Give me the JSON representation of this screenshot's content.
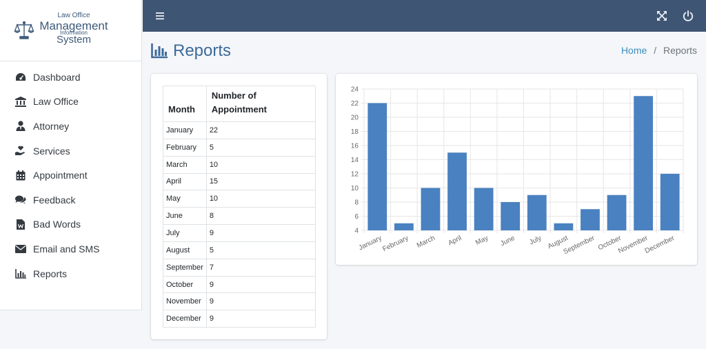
{
  "brand": {
    "line1": "Law Office",
    "line2": "Management",
    "line3": "Information",
    "line4": "System"
  },
  "sidebar": {
    "items": [
      {
        "label": "Dashboard",
        "icon": "tachometer-icon"
      },
      {
        "label": "Law Office",
        "icon": "landmark-icon"
      },
      {
        "label": "Attorney",
        "icon": "user-tie-icon"
      },
      {
        "label": "Services",
        "icon": "hand-holding-heart-icon"
      },
      {
        "label": "Appointment",
        "icon": "calendar-icon"
      },
      {
        "label": "Feedback",
        "icon": "comments-icon"
      },
      {
        "label": "Bad Words",
        "icon": "file-word-icon"
      },
      {
        "label": "Email and SMS",
        "icon": "envelope-icon"
      },
      {
        "label": "Reports",
        "icon": "chart-bar-icon"
      }
    ]
  },
  "header": {
    "title": "Reports",
    "breadcrumb_home": "Home",
    "breadcrumb_sep": "/",
    "breadcrumb_current": "Reports"
  },
  "table": {
    "headers": [
      "Month",
      "Number of Appointment"
    ],
    "rows": [
      [
        "January",
        "22"
      ],
      [
        "February",
        "5"
      ],
      [
        "March",
        "10"
      ],
      [
        "April",
        "15"
      ],
      [
        "May",
        "10"
      ],
      [
        "June",
        "8"
      ],
      [
        "July",
        "9"
      ],
      [
        "August",
        "5"
      ],
      [
        "September",
        "7"
      ],
      [
        "October",
        "9"
      ],
      [
        "November",
        "9"
      ],
      [
        "December",
        "9"
      ]
    ]
  },
  "colors": {
    "topbar": "#3e5573",
    "accent": "#3c8dbc",
    "bar_fill": "#4a81c0"
  },
  "chart_data": {
    "type": "bar",
    "categories": [
      "January",
      "February",
      "March",
      "April",
      "May",
      "June",
      "July",
      "August",
      "September",
      "October",
      "November",
      "December"
    ],
    "values": [
      22,
      5,
      10,
      15,
      10,
      8,
      9,
      5,
      7,
      9,
      23,
      12
    ],
    "title": "",
    "xlabel": "",
    "ylabel": "",
    "ylim": [
      4,
      24
    ],
    "yticks": [
      "4",
      "6",
      "8",
      "10",
      "12",
      "14",
      "16",
      "18",
      "20",
      "22",
      "24"
    ],
    "grid": true,
    "legend": "none"
  }
}
